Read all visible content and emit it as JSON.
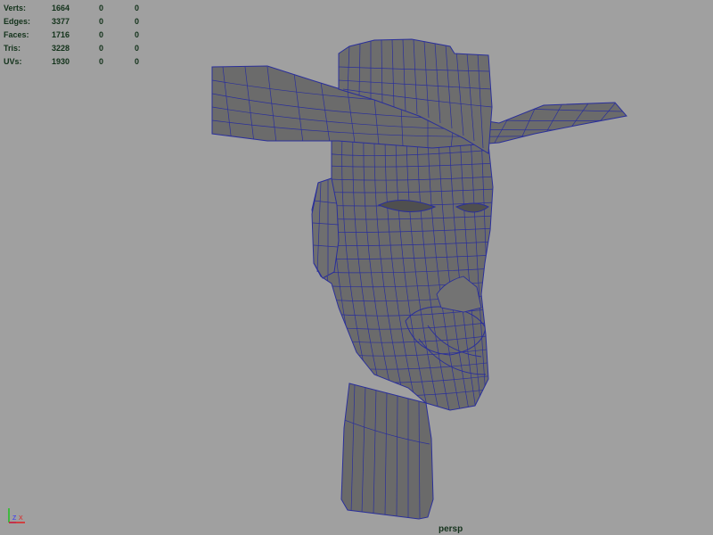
{
  "stats": [
    {
      "label": "Verts:",
      "values": [
        "1664",
        "0",
        "0"
      ]
    },
    {
      "label": "Edges:",
      "values": [
        "3377",
        "0",
        "0"
      ]
    },
    {
      "label": "Faces:",
      "values": [
        "1716",
        "0",
        "0"
      ]
    },
    {
      "label": "Tris:",
      "values": [
        "3228",
        "0",
        "0"
      ]
    },
    {
      "label": "UVs:",
      "values": [
        "1930",
        "0",
        "0"
      ]
    }
  ],
  "camera_label": "persp",
  "axis_labels": {
    "z": "Z",
    "x": "X"
  },
  "colors": {
    "background": "#a0a0a0",
    "mesh_fill": "#6b6b6b",
    "mesh_dark": "#5a5a5a",
    "wire": "#2a2f9a",
    "hud_text": "#12321a"
  }
}
